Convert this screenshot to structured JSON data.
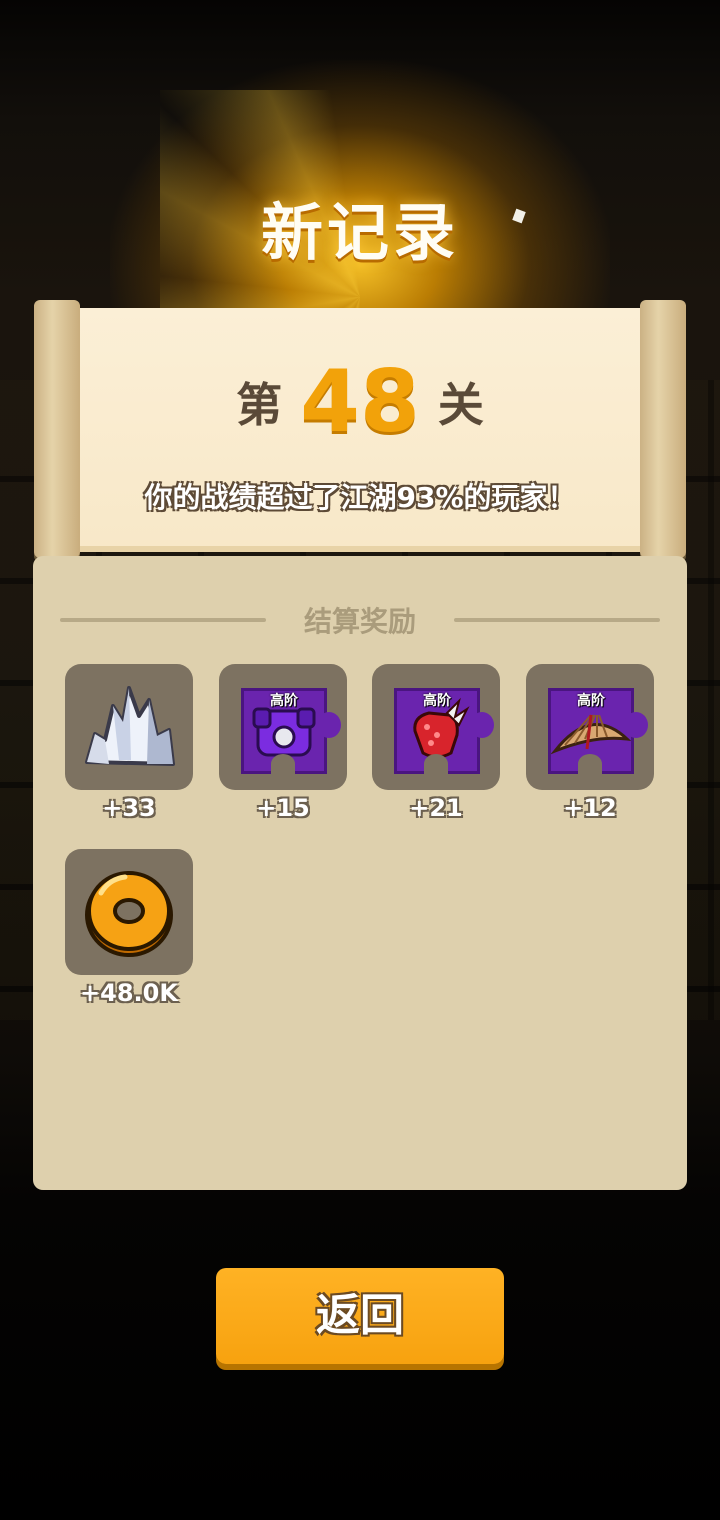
{
  "header": {
    "title": "新记录"
  },
  "result": {
    "level_prefix": "第",
    "level_number": "48",
    "level_suffix": "关",
    "subtitle": "你的战绩超过了江湖93%的玩家！"
  },
  "rewards": {
    "section_title": "结算奖励",
    "tier_label": "高阶",
    "items": [
      {
        "icon": "crystal-icon",
        "amount": "+33"
      },
      {
        "icon": "armor-piece-icon",
        "amount": "+15"
      },
      {
        "icon": "gauntlet-piece-icon",
        "amount": "+21"
      },
      {
        "icon": "straw-hat-piece-icon",
        "amount": "+12"
      },
      {
        "icon": "gold-coin-icon",
        "amount": "+48.0K"
      }
    ]
  },
  "back_button": {
    "label": "返回"
  },
  "colors": {
    "accent": "#f2a20a",
    "button": "#f7a20f",
    "panel": "#ded0ad",
    "tier_piece": "#6a24ae"
  }
}
